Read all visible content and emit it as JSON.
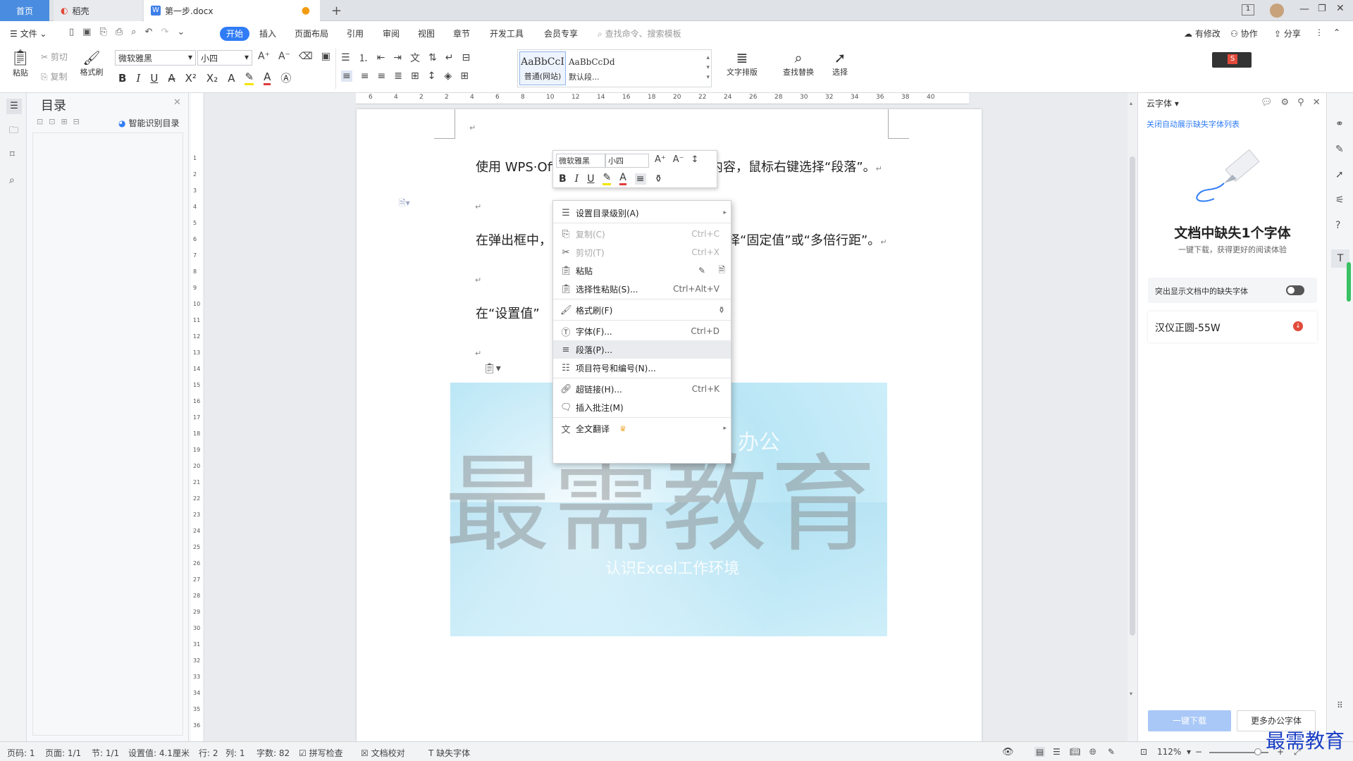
{
  "tabs": {
    "home": "首页",
    "daoke": "稻壳",
    "doc": "第一步.docx",
    "badge": "1"
  },
  "menu": {
    "file": "文件",
    "items": [
      "开始",
      "插入",
      "页面布局",
      "引用",
      "审阅",
      "视图",
      "章节",
      "开发工具",
      "会员专享"
    ],
    "search_placeholder": "查找命令、搜索模板",
    "modified": "有修改",
    "collab": "协作",
    "share": "分享"
  },
  "ribbon": {
    "paste": "粘贴",
    "cut": "剪切",
    "copy": "复制",
    "format_painter": "格式刷",
    "font_name": "微软雅黑",
    "font_size": "小四",
    "style1_preview": "AaBbCcI",
    "style1_name": "普通(网站)",
    "style2_preview": "AaBbCcDd",
    "style2_name": "默认段...",
    "text_layout": "文字排版",
    "find_replace": "查找替换",
    "select": "选择"
  },
  "toc": {
    "title": "目录",
    "smart": "智能识别目录"
  },
  "ruler_h_ticks": [
    "6",
    "4",
    "2",
    "2",
    "4",
    "6",
    "8",
    "10",
    "12",
    "14",
    "16",
    "18",
    "20",
    "22",
    "24",
    "26",
    "28",
    "30",
    "32",
    "34",
    "36",
    "38",
    "40"
  ],
  "ruler_v_ticks": [
    "1",
    "2",
    "3",
    "4",
    "5",
    "6",
    "7",
    "8",
    "9",
    "10",
    "11",
    "12",
    "13",
    "14",
    "15",
    "16",
    "17",
    "18",
    "19",
    "20",
    "21",
    "22",
    "23",
    "24",
    "25",
    "26",
    "27",
    "28",
    "29",
    "30",
    "31",
    "32",
    "33",
    "34",
    "35",
    "36"
  ],
  "document": {
    "line1a": "使用 WPS·Off",
    "line1b": "的内容，鼠标右键选择“段落”。",
    "line2a": "在弹出框中，",
    "line2b": "择“固定值”或“多倍行距”。",
    "line3a": "在“设置值”",
    "return_mark": "↵",
    "watermark": "最需教育",
    "image_text1": "办公",
    "image_text2": "认识Excel工作环境"
  },
  "mini_toolbar": {
    "font_name": "微软雅黑",
    "font_size": "小四"
  },
  "context_menu": {
    "items": [
      {
        "label": "设置目录级别(A)",
        "shortcut": "",
        "icon": "toc-level-icon",
        "disabled": false,
        "arrow": true
      },
      {
        "label": "复制(C)",
        "shortcut": "Ctrl+C",
        "icon": "copy-icon",
        "disabled": true,
        "arrow": false
      },
      {
        "label": "剪切(T)",
        "shortcut": "Ctrl+X",
        "icon": "cut-icon",
        "disabled": true,
        "arrow": false
      },
      {
        "label": "粘贴",
        "shortcut": "",
        "icon": "paste-icon",
        "disabled": false,
        "arrow": false
      },
      {
        "label": "选择性粘贴(S)...",
        "shortcut": "Ctrl+Alt+V",
        "icon": "paste-special-icon",
        "disabled": false,
        "arrow": false
      },
      {
        "label": "格式刷(F)",
        "shortcut": "",
        "icon": "format-painter-icon",
        "disabled": false,
        "arrow": false
      },
      {
        "label": "字体(F)...",
        "shortcut": "Ctrl+D",
        "icon": "font-icon",
        "disabled": false,
        "arrow": false
      },
      {
        "label": "段落(P)...",
        "shortcut": "",
        "icon": "paragraph-icon",
        "disabled": false,
        "arrow": false
      },
      {
        "label": "项目符号和编号(N)...",
        "shortcut": "",
        "icon": "bullets-icon",
        "disabled": false,
        "arrow": false
      },
      {
        "label": "超链接(H)...",
        "shortcut": "Ctrl+K",
        "icon": "hyperlink-icon",
        "disabled": false,
        "arrow": false
      },
      {
        "label": "插入批注(M)",
        "shortcut": "",
        "icon": "comment-icon",
        "disabled": false,
        "arrow": false
      },
      {
        "label": "全文翻译",
        "shortcut": "",
        "icon": "translate-icon",
        "disabled": false,
        "arrow": true
      }
    ]
  },
  "right_panel": {
    "title": "云字体",
    "link": "关闭自动展示缺失字体列表",
    "heading": "文档中缺失1个字体",
    "subheading": "一键下载，获得更好的阅读体验",
    "toggle_label": "突出显示文档中的缺失字体",
    "font_item": "汉仪正圆-55W",
    "download_btn": "一键下载",
    "more_btn": "更多办公字体"
  },
  "status": {
    "page": "页码: 1",
    "pages": "页面: 1/1",
    "section": "节: 1/1",
    "setting": "设置值: 4.1厘米",
    "row": "行: 2",
    "col": "列: 1",
    "words": "字数: 82",
    "spell": "拼写检查",
    "proof": "文档校对",
    "missing_font": "缺失字体",
    "zoom": "112%"
  },
  "brand": "最需教育",
  "colors": {
    "accent": "#2f7cf6",
    "tab_active": "#4a8de0"
  }
}
